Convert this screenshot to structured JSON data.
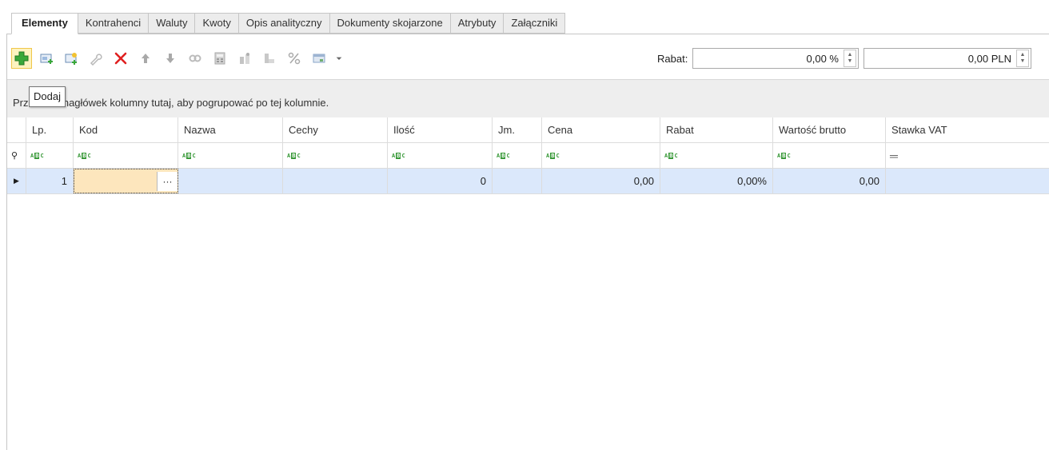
{
  "tabs": [
    "Elementy",
    "Kontrahenci",
    "Waluty",
    "Kwoty",
    "Opis analityczny",
    "Dokumenty skojarzone",
    "Atrybuty",
    "Załączniki"
  ],
  "toolbar": {
    "icons": [
      "add-icon",
      "add-item-icon",
      "add-new-item-icon",
      "wrench-icon",
      "delete-icon",
      "arrow-up-icon",
      "arrow-down-icon",
      "link-icon",
      "calculator-icon",
      "stock-icon",
      "warehouse-icon",
      "percent-icon",
      "view-icon",
      "dropdown-icon"
    ],
    "tooltip": "Dodaj",
    "rabat_label": "Rabat:",
    "rabat_percent": "0,00 %",
    "rabat_pln": "0,00 PLN"
  },
  "group_panel": {
    "text_visible_start": "Prz",
    "text_visible_end": "nagłówek kolumny tutaj, aby pogrupować po tej kolumnie."
  },
  "grid": {
    "columns": [
      "Lp.",
      "Kod",
      "Nazwa",
      "Cechy",
      "Ilość",
      "Jm.",
      "Cena",
      "Rabat",
      "Wartość brutto",
      "Stawka VAT"
    ],
    "rows": [
      {
        "lp": "1",
        "kod": "",
        "nazwa": "",
        "cechy": "",
        "ilosc": "0",
        "jm": "",
        "cena": "0,00",
        "rabat": "0,00%",
        "wartosc": "0,00",
        "vat": ""
      }
    ]
  },
  "colors": {
    "selected_row": "#dbe8fb",
    "edit_cell": "#fde6bd",
    "add_icon": "#3aa83a",
    "delete_icon": "#e02020"
  }
}
